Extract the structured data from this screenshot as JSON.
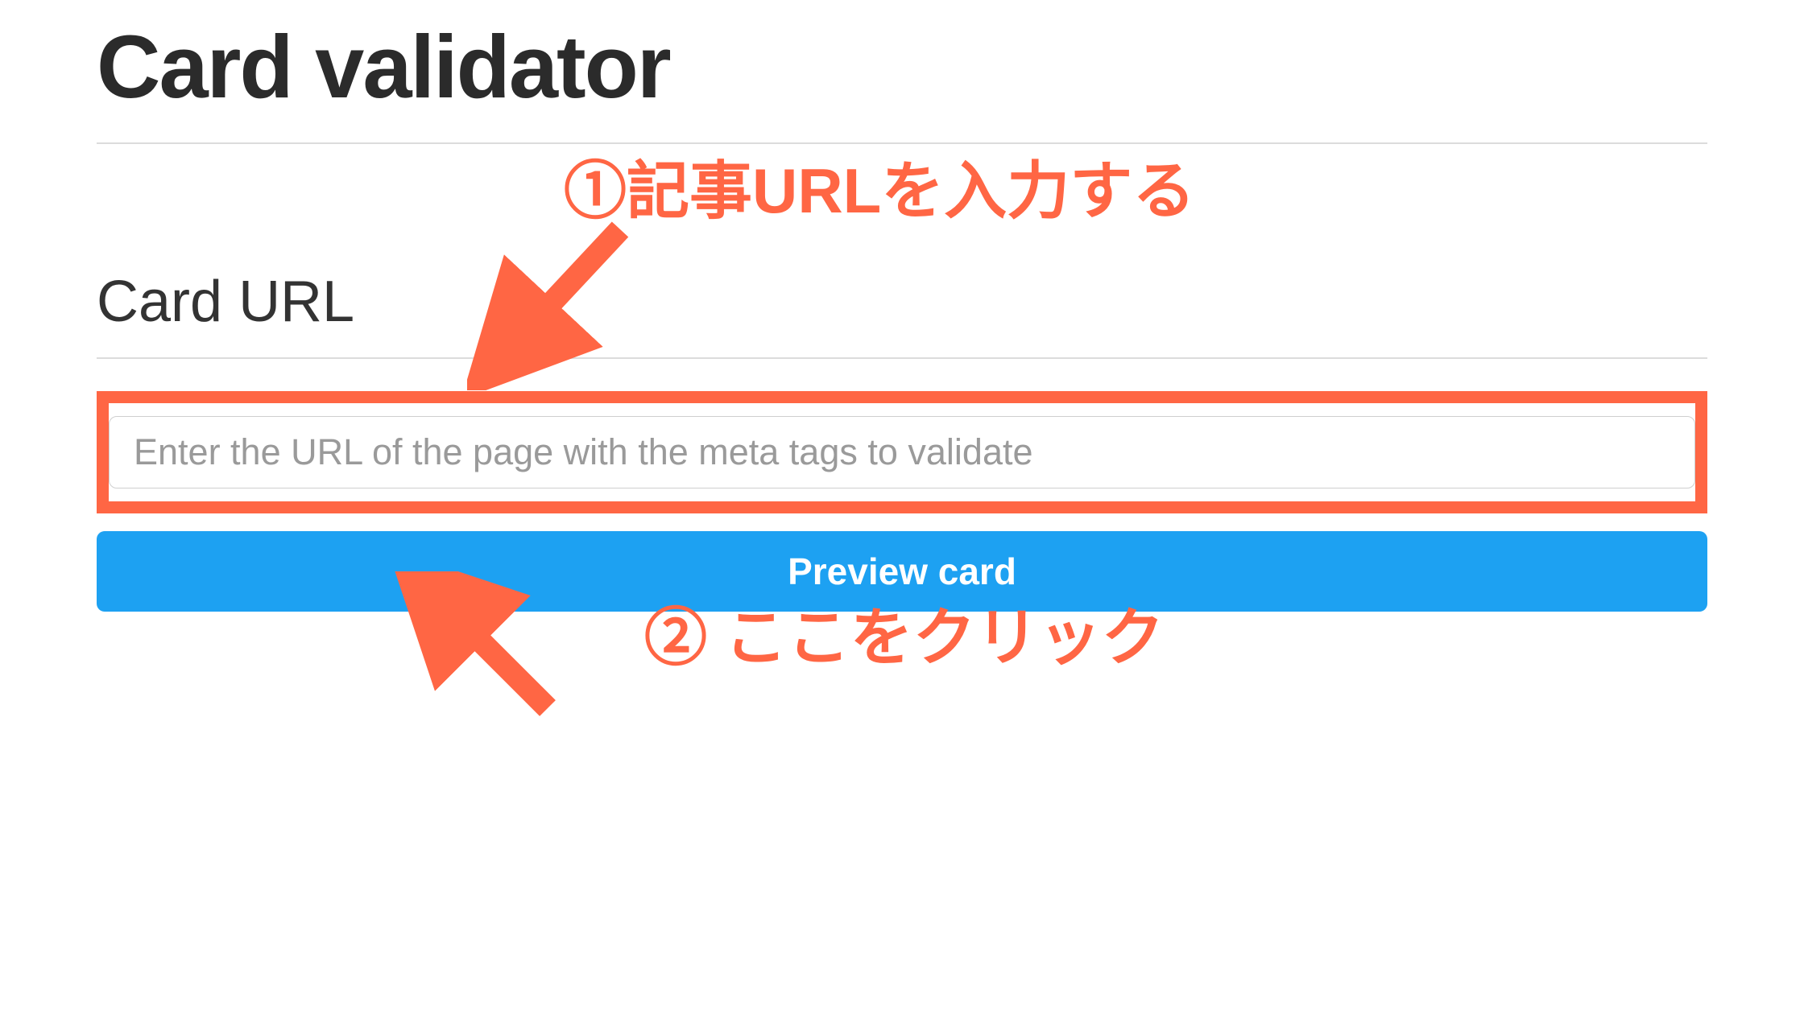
{
  "header": {
    "title": "Card validator"
  },
  "section": {
    "label": "Card URL"
  },
  "input": {
    "placeholder": "Enter the URL of the page with the meta tags to validate",
    "value": ""
  },
  "button": {
    "label": "Preview card"
  },
  "annotations": {
    "step1": "①記事URLを入力する",
    "step2": "② ここをクリック"
  },
  "colors": {
    "annotation": "#ff6644",
    "button_bg": "#1da1f2",
    "button_text": "#ffffff",
    "title_text": "#2b2b2b",
    "divider": "#dcdcdc"
  }
}
